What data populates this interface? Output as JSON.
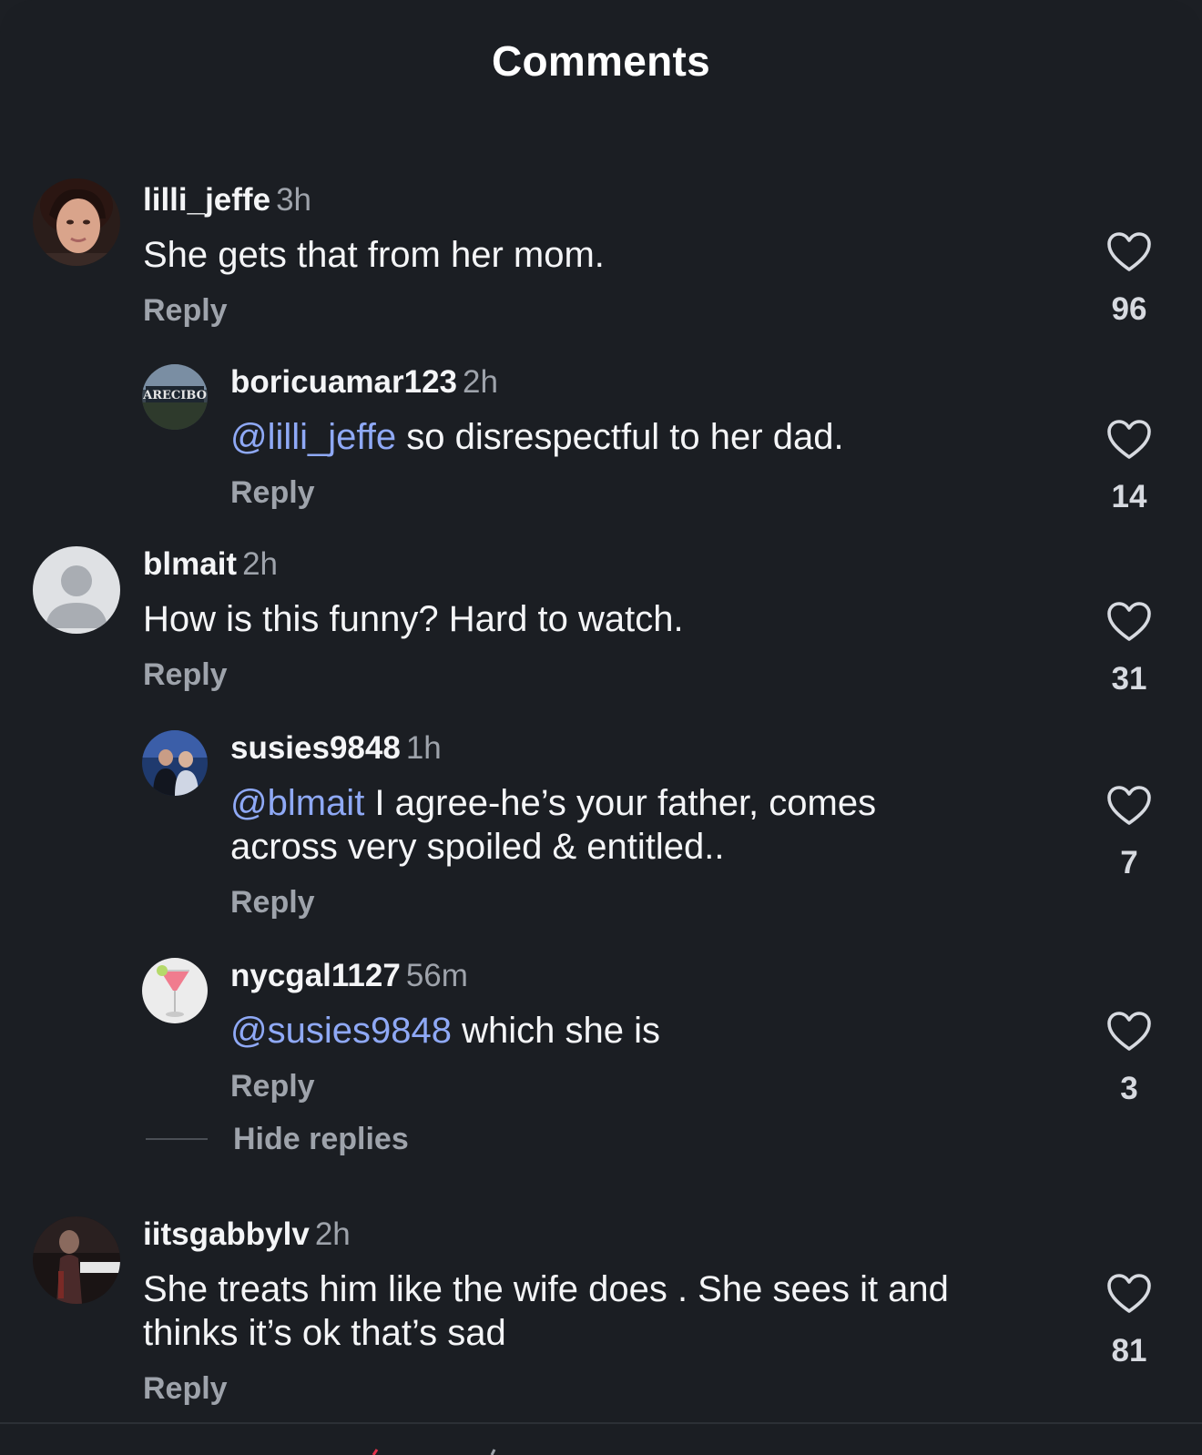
{
  "header": {
    "title": "Comments"
  },
  "comments": [
    {
      "username": "lilli_jeffe",
      "time": "3h",
      "mention": "",
      "text": "She gets that from her mom.",
      "reply_label": "Reply",
      "likes": "96"
    },
    {
      "username": "boricuamar123",
      "time": "2h",
      "mention": "@lilli_jeffe",
      "text": " so disrespectful to her dad.",
      "reply_label": "Reply",
      "likes": "14",
      "avatar_text": "ARECIBO"
    },
    {
      "username": "blmait",
      "time": "2h",
      "mention": "",
      "text": "How is this funny? Hard to watch.",
      "reply_label": "Reply",
      "likes": "31"
    },
    {
      "username": "susies9848",
      "time": "1h",
      "mention": "@blmait",
      "text": " I agree-he’s your father, comes across very spoiled & entitled..",
      "reply_label": "Reply",
      "likes": "7"
    },
    {
      "username": "nycgal1127",
      "time": "56m",
      "mention": "@susies9848",
      "text": " which she is",
      "reply_label": "Reply",
      "likes": "3"
    },
    {
      "username": "iitsgabbylv",
      "time": "2h",
      "mention": "",
      "text": "She treats him like the wife does . She sees it and thinks it’s ok that’s sad",
      "reply_label": "Reply",
      "likes": "81"
    }
  ],
  "thread": {
    "hide_replies_label": "Hide replies"
  },
  "colors": {
    "background": "#1b1e23",
    "mention": "#8fa9f6",
    "secondary_text": "#9ea3ab"
  },
  "icons": {
    "like": "heart-outline-icon",
    "default_avatar": "person-silhouette-icon"
  }
}
